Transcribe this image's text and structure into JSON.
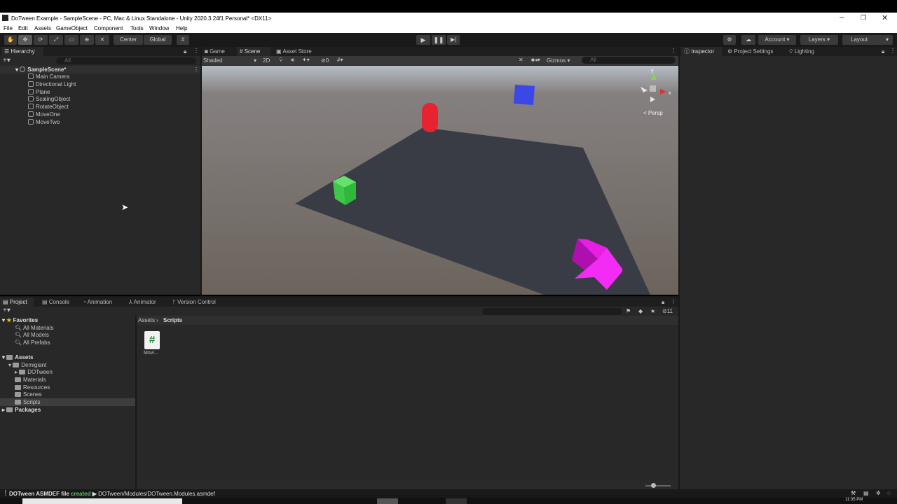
{
  "window": {
    "title": "DoTween Example - SampleScene - PC, Mac & Linux Standalone - Unity 2020.3.24f1 Personal* <DX11>"
  },
  "menu": [
    "File",
    "Edit",
    "Assets",
    "GameObject",
    "Component",
    "Tools",
    "Window",
    "Help"
  ],
  "toolbar": {
    "center_label": "Center",
    "global_label": "Global",
    "account_label": "Account",
    "layers_label": "Layers",
    "layout_label": "Layout"
  },
  "hierarchy": {
    "tab": "Hierarchy",
    "search_placeholder": "All",
    "scene": "SampleScene*",
    "items": [
      "Main Camera",
      "Directional Light",
      "Plane",
      "ScalingObject",
      "RotateObject",
      "MoveOne",
      "MoveTwo"
    ]
  },
  "scene_view": {
    "tabs": [
      "Game",
      "Scene",
      "Asset Store"
    ],
    "shading": "Shaded",
    "mode_2d": "2D",
    "hidden_count": "0",
    "gizmos": "Gizmos",
    "search_placeholder": "All",
    "persp": "< Persp",
    "axis": {
      "x": "x",
      "y": "y"
    }
  },
  "inspector": {
    "tabs": [
      "Inspector",
      "Project Settings",
      "Lighting"
    ]
  },
  "project": {
    "tabs": [
      "Project",
      "Console",
      "Animation",
      "Animator",
      "Version Control"
    ],
    "hidden_count": "11",
    "favorites_label": "Favorites",
    "favorites": [
      "All Materials",
      "All Models",
      "All Prefabs"
    ],
    "assets_label": "Assets",
    "assets_tree": [
      {
        "label": "Demigiant",
        "level": 1
      },
      {
        "label": "DOTween",
        "level": 2
      },
      {
        "label": "Materials",
        "level": 1
      },
      {
        "label": "Resources",
        "level": 1
      },
      {
        "label": "Scenes",
        "level": 1
      },
      {
        "label": "Scripts",
        "level": 1
      }
    ],
    "packages_label": "Packages",
    "breadcrumb": [
      "Assets",
      "Scripts"
    ],
    "file": {
      "name": "Movi...",
      "glyph": "#"
    }
  },
  "status": {
    "prefix": "DOTween ASMDEF file",
    "word": "created",
    "path": "DOTween/Modules/DOTween.Modules.asmdef"
  },
  "clock": "11:35 PM"
}
